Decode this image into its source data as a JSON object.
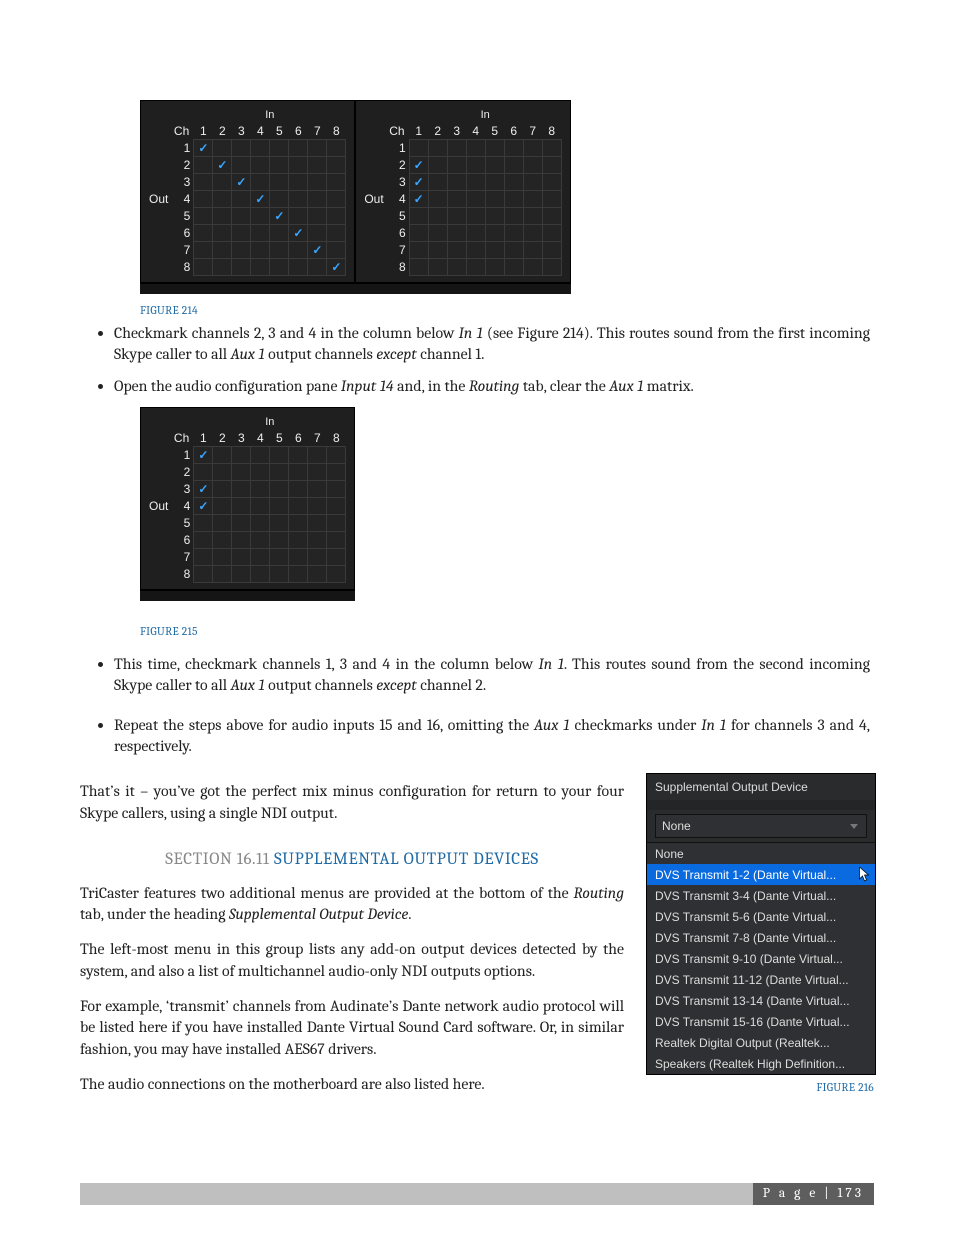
{
  "figures": {
    "f214": {
      "caption": "FIGURE 214",
      "axis_in": "In",
      "axis_out": "Out",
      "axis_ch": "Ch",
      "cols": [
        "1",
        "2",
        "3",
        "4",
        "5",
        "6",
        "7",
        "8"
      ],
      "rows": [
        "1",
        "2",
        "3",
        "4",
        "5",
        "6",
        "7",
        "8"
      ],
      "left_checks": [
        [
          0,
          0
        ],
        [
          1,
          1
        ],
        [
          2,
          2
        ],
        [
          3,
          3
        ],
        [
          4,
          4
        ],
        [
          5,
          5
        ],
        [
          6,
          6
        ],
        [
          7,
          7
        ]
      ],
      "right_checks": [
        [
          1,
          0
        ],
        [
          2,
          0
        ],
        [
          3,
          0
        ]
      ]
    },
    "f215": {
      "caption": "FIGURE 215",
      "axis_in": "In",
      "axis_out": "Out",
      "axis_ch": "Ch",
      "cols": [
        "1",
        "2",
        "3",
        "4",
        "5",
        "6",
        "7",
        "8"
      ],
      "rows": [
        "1",
        "2",
        "3",
        "4",
        "5",
        "6",
        "7",
        "8"
      ],
      "checks": [
        [
          0,
          0
        ],
        [
          2,
          0
        ],
        [
          3,
          0
        ]
      ]
    },
    "f216": {
      "caption": "FIGURE 216"
    }
  },
  "bullets": {
    "b1a": "Checkmark channels 2, 3 and 4 in the column below ",
    "b1b": "In 1",
    "b1c": " (see Figure 214). This routes sound from the first incoming Skype caller to all ",
    "b1d": "Aux 1",
    "b1e": " output channels ",
    "b1f": "except",
    "b1g": " channel 1.",
    "b2a": "Open the audio configuration pane ",
    "b2b": "Input 14",
    "b2c": " and, in the ",
    "b2d": "Routing",
    "b2e": " tab, clear the ",
    "b2f": "Aux 1",
    "b2g": " matrix.",
    "b3a": "This time, checkmark channels 1, 3 and 4 in the column below ",
    "b3b": "In 1",
    "b3c": ". This routes sound from the second incoming Skype caller to all ",
    "b3d": "Aux 1",
    "b3e": " output channels ",
    "b3f": "except",
    "b3g": " channel 2.",
    "b4a": "Repeat the steps above for audio inputs 15 and 16, omitting the ",
    "b4b": "Aux 1",
    "b4c": " checkmarks under ",
    "b4d": "In 1",
    "b4e": " for channels 3 and 4, respectively."
  },
  "paras": {
    "p1": "That’s it – you’ve got the perfect mix minus configuration for return to your four Skype callers, using a single NDI output.",
    "p2a": "TriCaster features two additional menus are provided at the bottom of the ",
    "p2b": "Routing",
    "p2c": " tab, under the heading ",
    "p2d": "Supplemental Output Device",
    "p2e": ".",
    "p3": "The left-most menu in this group lists any add-on output devices detected by the system, and also a list of multichannel audio-only NDI outputs options.",
    "p4": "For example, ‘transmit’ channels from Audinate’s Dante network audio protocol will be listed here if you have installed Dante Virtual Sound Card software. Or, in similar fashion, you may have installed AES67 drivers.",
    "p5": "The audio connections on the motherboard are also listed here."
  },
  "section": {
    "num": "SECTION 16.11 ",
    "title": "SUPPLEMENTAL OUTPUT DEVICES"
  },
  "sod": {
    "title": "Supplemental Output Device",
    "selected": "None",
    "items": [
      "None",
      "DVS Transmit  1-2 (Dante Virtual...",
      "DVS Transmit  3-4 (Dante Virtual...",
      "DVS Transmit  5-6 (Dante Virtual...",
      "DVS Transmit  7-8 (Dante Virtual...",
      "DVS Transmit  9-10 (Dante Virtual...",
      "DVS Transmit 11-12 (Dante Virtual...",
      "DVS Transmit 13-14 (Dante Virtual...",
      "DVS Transmit 15-16 (Dante Virtual...",
      "Realtek Digital Output (Realtek...",
      "Speakers (Realtek High Definition..."
    ],
    "highlight_index": 1
  },
  "footer": {
    "label": "P a g e",
    "sep": " | ",
    "num": "173"
  }
}
